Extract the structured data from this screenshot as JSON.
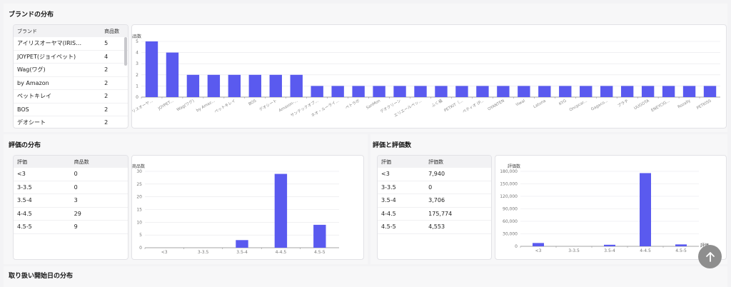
{
  "sections": {
    "brand_title": "ブランドの分布",
    "rating_title": "評価の分布",
    "rating_count_title": "評価と評価数",
    "start_date_title": "取り扱い開始日の分布"
  },
  "brand_table": {
    "headers": [
      "ブランド",
      "商品数"
    ],
    "rows": [
      [
        "アイリスオーヤマ(IRIS…",
        "5"
      ],
      [
        "JOYPET(ジョイペット)",
        "4"
      ],
      [
        "Wag(ワグ)",
        "2"
      ],
      [
        "by Amazon",
        "2"
      ],
      [
        "ペットキレイ",
        "2"
      ],
      [
        "BOS",
        "2"
      ],
      [
        "デオシート",
        "2"
      ]
    ]
  },
  "rating_table": {
    "headers": [
      "評価",
      "商品数"
    ],
    "rows": [
      [
        "<3",
        "0"
      ],
      [
        "3-3.5",
        "0"
      ],
      [
        "3.5-4",
        "3"
      ],
      [
        "4-4.5",
        "29"
      ],
      [
        "4.5-5",
        "9"
      ]
    ]
  },
  "rating_count_table": {
    "headers": [
      "評価",
      "評価数"
    ],
    "rows": [
      [
        "<3",
        "7,940"
      ],
      [
        "3-3.5",
        "0"
      ],
      [
        "3.5-4",
        "3,706"
      ],
      [
        "4-4.5",
        "175,774"
      ],
      [
        "4.5-5",
        "4,553"
      ]
    ]
  },
  "colors": {
    "bar": "#5a5aef",
    "grid": "#e6e6ea",
    "axis": "#888888"
  },
  "chart_data": [
    {
      "type": "bar",
      "ylabel": "商品数",
      "ylim": [
        0,
        5
      ],
      "yticks": [
        0,
        1,
        2,
        3,
        4,
        5
      ],
      "categories": [
        "イリスオーヤ...",
        "JOYPET...",
        "Wag(ワグ)",
        "by Amaz...",
        "ペットキレイ",
        "BOS",
        "デオシート",
        "Amazon-...",
        "サンテックオプ...",
        "ネオ・ルーライ...",
        "ペトラボ",
        "SanMon",
        "デオクリーン",
        "エリエールペッ...",
        "ふく福",
        "PETKIT（...",
        "ペティオ (P...",
        "OYANTEN",
        "Yiwal",
        "Latuna",
        "KYG",
        "Oncpcar...",
        "Gagaco...",
        "プラチ",
        "UUGOTA",
        "ENEYCIG...",
        "Rozally",
        "PETKISS"
      ],
      "values": [
        5,
        4,
        2,
        2,
        2,
        2,
        2,
        2,
        1,
        1,
        1,
        1,
        1,
        1,
        1,
        1,
        1,
        1,
        1,
        1,
        1,
        1,
        1,
        1,
        1,
        1,
        1,
        1
      ]
    },
    {
      "type": "bar",
      "ylabel": "商品数",
      "ylim": [
        0,
        30
      ],
      "yticks": [
        0,
        5,
        10,
        15,
        20,
        25,
        30
      ],
      "categories": [
        "<3",
        "3-3.5",
        "3.5-4",
        "4-4.5",
        "4.5-5"
      ],
      "values": [
        0,
        0,
        3,
        29,
        9
      ]
    },
    {
      "type": "bar",
      "ylabel": "評価数",
      "xlabel": "評価",
      "ylim": [
        0,
        180000
      ],
      "yticks": [
        0,
        30000,
        60000,
        90000,
        120000,
        150000,
        180000
      ],
      "ytick_labels": [
        "0",
        "30,000",
        "60,000",
        "90,000",
        "120,000",
        "150,000",
        "180,000"
      ],
      "categories": [
        "<3",
        "3-3.5",
        "3.5-4",
        "4-4.5",
        "4.5-5"
      ],
      "values": [
        7940,
        0,
        3706,
        175774,
        4553
      ]
    }
  ]
}
